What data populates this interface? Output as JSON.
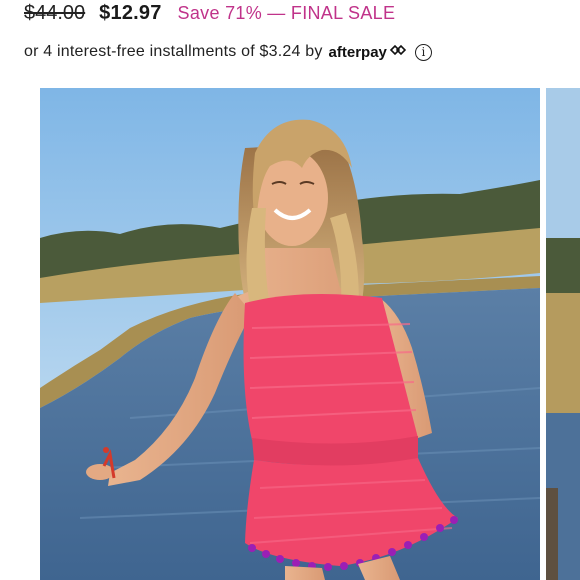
{
  "pricing": {
    "original_price": "$44.00",
    "sale_price": "$12.97",
    "save_text": "Save 71% — FINAL SALE"
  },
  "installments": {
    "text": "or 4 interest-free installments of $3.24 by",
    "provider_logo_text": "afterpay",
    "provider_icon": "afterpay-arrows-icon",
    "info_icon": "info-icon",
    "info_glyph": "i"
  },
  "gallery": {
    "main_image": "model-in-pink-strapless-romper-on-dock",
    "next_image": "next-product-photo-peek"
  },
  "colors": {
    "save_text": "#c0338a",
    "dress": "#f0466a",
    "pom_trim": "#9b1fb5"
  }
}
